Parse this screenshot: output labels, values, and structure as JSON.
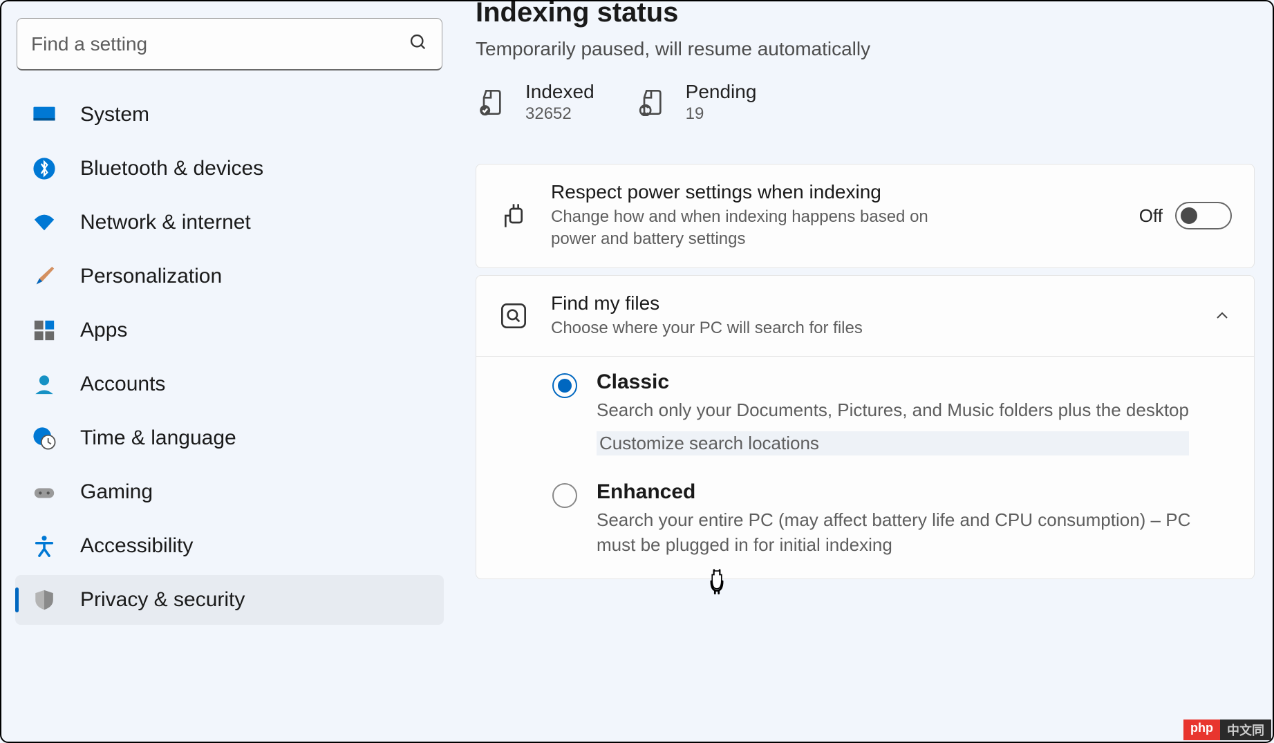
{
  "search": {
    "placeholder": "Find a setting"
  },
  "sidebar": {
    "items": [
      {
        "label": "System"
      },
      {
        "label": "Bluetooth & devices"
      },
      {
        "label": "Network & internet"
      },
      {
        "label": "Personalization"
      },
      {
        "label": "Apps"
      },
      {
        "label": "Accounts"
      },
      {
        "label": "Time & language"
      },
      {
        "label": "Gaming"
      },
      {
        "label": "Accessibility"
      },
      {
        "label": "Privacy & security"
      }
    ]
  },
  "page": {
    "title": "Indexing status",
    "subtitle": "Temporarily paused, will resume automatically"
  },
  "stats": {
    "indexed_label": "Indexed",
    "indexed_value": "32652",
    "pending_label": "Pending",
    "pending_value": "19"
  },
  "power_card": {
    "title": "Respect power settings when indexing",
    "desc": "Change how and when indexing happens based on power and battery settings",
    "toggle_state": "Off"
  },
  "find_card": {
    "title": "Find my files",
    "desc": "Choose where your PC will search for files",
    "options": {
      "classic": {
        "title": "Classic",
        "desc": "Search only your Documents, Pictures, and Music folders plus the desktop",
        "link": "Customize search locations"
      },
      "enhanced": {
        "title": "Enhanced",
        "desc": "Search your entire PC (may affect battery life and CPU consumption) – PC must be plugged in for initial indexing"
      }
    }
  },
  "watermark": {
    "a": "php",
    "b": "中文同"
  }
}
